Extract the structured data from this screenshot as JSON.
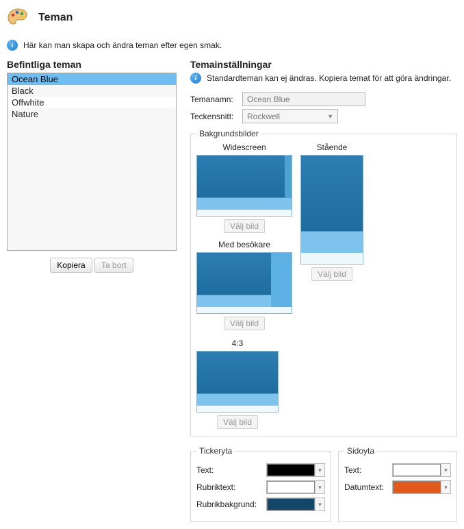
{
  "header": {
    "title": "Teman"
  },
  "info_main": "Här kan man skapa och ändra teman efter egen smak.",
  "left": {
    "section_title": "Befintliga teman",
    "items": [
      "Ocean Blue",
      "Black",
      "Offwhite",
      "Nature"
    ],
    "selected_index": 0,
    "copy_label": "Kopiera",
    "delete_label": "Ta bort"
  },
  "right": {
    "section_title": "Temainställningar",
    "info": "Standardteman kan ej ändras. Kopiera temat för att göra ändringar.",
    "name_label": "Temanamn:",
    "name_value": "Ocean Blue",
    "font_label": "Teckensnitt:",
    "font_value": "Rockwell",
    "bg_legend": "Bakgrundsbilder",
    "thumbs": {
      "widescreen": "Widescreen",
      "portrait": "Stående",
      "four_three": "4:3",
      "with_visitor": "Med besökare",
      "pick_image": "Välj bild"
    },
    "ticker": {
      "legend": "Tickeryta",
      "text_label": "Text:",
      "headline_label": "Rubriktext:",
      "headline_bg_label": "Rubrikbakgrund:",
      "text_color": "#000000",
      "headline_color": "#ffffff",
      "headline_bg_color": "#13476a"
    },
    "side": {
      "legend": "Sidoyta",
      "text_label": "Text:",
      "date_label": "Datumtext:",
      "text_color": "#ffffff",
      "date_color": "#e25a1b"
    }
  }
}
